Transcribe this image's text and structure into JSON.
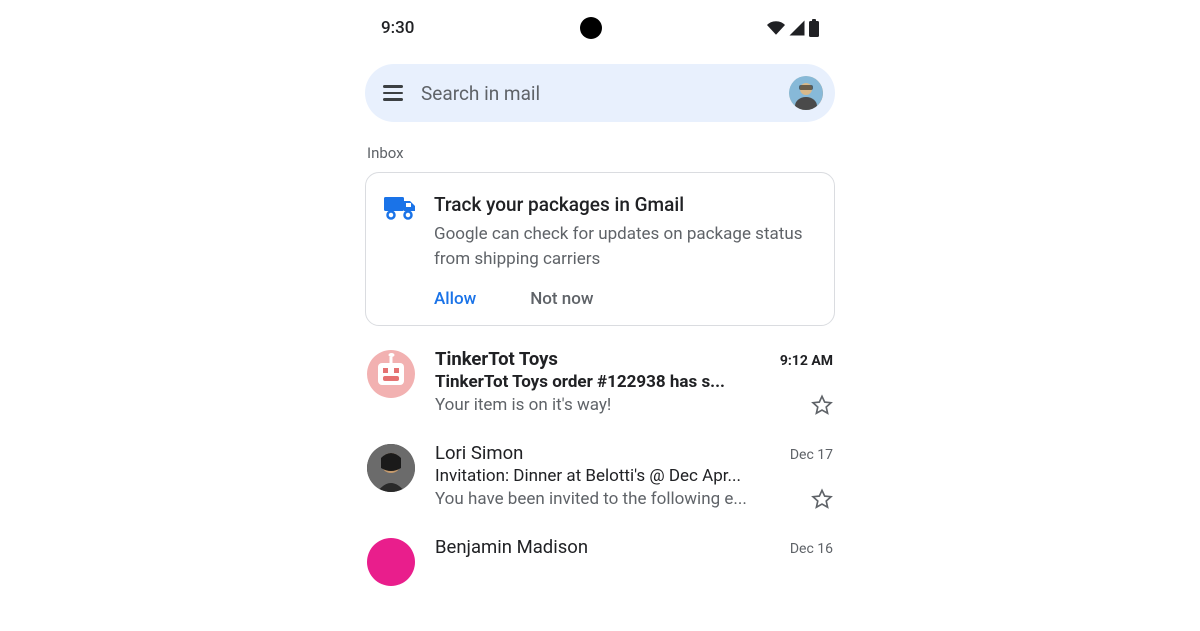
{
  "status": {
    "time": "9:30"
  },
  "search": {
    "placeholder": "Search in mail"
  },
  "section": {
    "label": "Inbox"
  },
  "promo": {
    "title": "Track your packages in Gmail",
    "desc": "Google can check for updates on package status from shipping carriers",
    "allow_label": "Allow",
    "notnow_label": "Not now"
  },
  "emails": [
    {
      "sender": "TinkerTot Toys",
      "time": "9:12 AM",
      "subject": "TinkerTot Toys order #122938 has s...",
      "snippet": "Your item is on it's way!",
      "unread": true
    },
    {
      "sender": "Lori Simon",
      "time": "Dec 17",
      "subject": "Invitation: Dinner at Belotti's @ Dec Apr...",
      "snippet": "You have been invited to the following e...",
      "unread": false
    },
    {
      "sender": "Benjamin Madison",
      "time": "Dec 16",
      "subject": "",
      "snippet": "",
      "unread": false
    }
  ]
}
